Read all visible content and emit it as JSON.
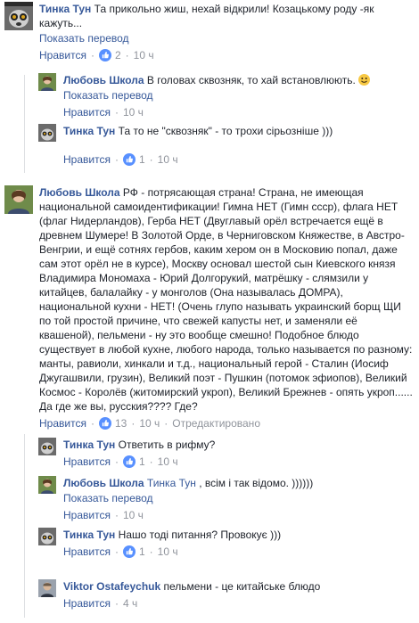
{
  "ui": {
    "translate": "Показать перевод",
    "like": "Нравится",
    "edited": "Отредактировано",
    "dot": "·"
  },
  "comments": [
    {
      "author": "Тинка Тун",
      "text": "Та прикольно жиш, нехай відкрили! Козацькому роду -як кажуть...",
      "likes": "2",
      "time": "10 ч",
      "avatar": "lemur"
    },
    {
      "author": "Любовь Школа",
      "text": "В головах сквозняк, то хай встановлюють. ",
      "time": "10 ч",
      "avatar": "woman",
      "emoji": "smile-emoji"
    },
    {
      "author": "Тинка Тун",
      "text": "Та то не \"сквозняк\" - то трохи сірьозніше )))",
      "likes": "1",
      "time": "10 ч",
      "avatar": "lemur"
    },
    {
      "author": "Любовь Школа",
      "text": "РФ - потрясающая страна! Страна, не имеющая национальной самоидентификации! Гимна НЕТ (Гимн ссср), флага НЕТ (флаг Нидерландов), Герба НЕТ (Двуглавый орёл встречается ещё в древнем Шумере! В Золотой Орде, в Черниговском Княжестве, в Австро-Венгрии, и ещё сотнях гербов, каким хером он в Московию попал, даже сам этот орёл не в курсе), Москву основал шестой сын Киевского князя Владимира Мономаха - Юрий Долгорукий, матрёшку - слямзили у китайцев, балалайку - у монголов (Она называлась ДОМРА), национальной кухни - НЕТ! (Очень глупо называть украинский борщ ЩИ по той простой причине, что свежей капусты нет, и заменяли её квашеной), пельмени - ну это вообще смешно! Подобное блюдо существует в любой кухне, любого народа, только называется по разному: манты, равиоли, хинкали и т.д., национальный герой - Сталин (Иосиф Джугашвили, грузин), Великий поэт - Пушкин (потомок эфиопов), Великий Космос - Королёв (житомирский укроп), Великий Брежнев - опять укроп...... Да где же вы, русския???? Где?",
      "likes": "13",
      "time": "10 ч",
      "avatar": "woman"
    },
    {
      "author": "Тинка Тун",
      "text": "Ответить в рифму?",
      "likes": "1",
      "time": "10 ч",
      "avatar": "lemur"
    },
    {
      "author": "Любовь Школа",
      "mention": "Тинка Тун",
      "text": ", всім і так відомо. ))))))",
      "time": "10 ч",
      "avatar": "woman"
    },
    {
      "author": "Тинка Тун",
      "text": "Нашо тоді питання? Провокує )))",
      "likes": "1",
      "time": "10 ч",
      "avatar": "lemur"
    },
    {
      "author": "Viktor Ostafeychuk",
      "text": "пельмени - це китайське блюдо",
      "time": "4 ч",
      "avatar": "man"
    }
  ],
  "colors": {
    "link": "#365899",
    "meta": "#90949c",
    "like_badge": "#5890ff"
  }
}
